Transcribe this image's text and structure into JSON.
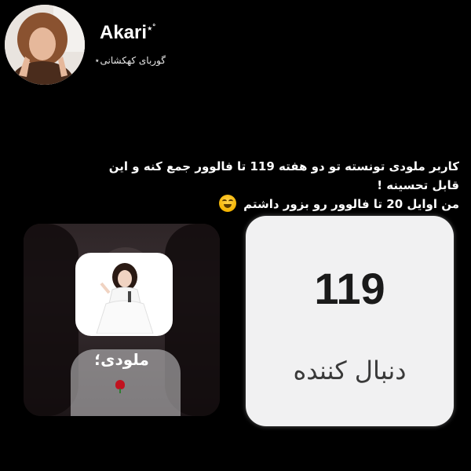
{
  "header": {
    "username": "Akari",
    "username_badge": "⋆˚",
    "bio": "گوربای کهکشانی⋆"
  },
  "post": {
    "caption_line1": "کاربر ملودی تونسته تو دو هفته 119 تا فالوور جمع کنه و این قابل تحسینه !",
    "caption_line2": "من اوایل 20 تا فالوور رو بزور داشتم",
    "emoji": "grinning-sweat-face"
  },
  "profile_card": {
    "name": "ملودی؛",
    "flower_icon": "rose-icon"
  },
  "follower_card": {
    "count": "119",
    "label": "دنبال کننده"
  },
  "colors": {
    "background": "#000000",
    "card_light": "#f1f1f2",
    "rose": "#c1121f"
  }
}
